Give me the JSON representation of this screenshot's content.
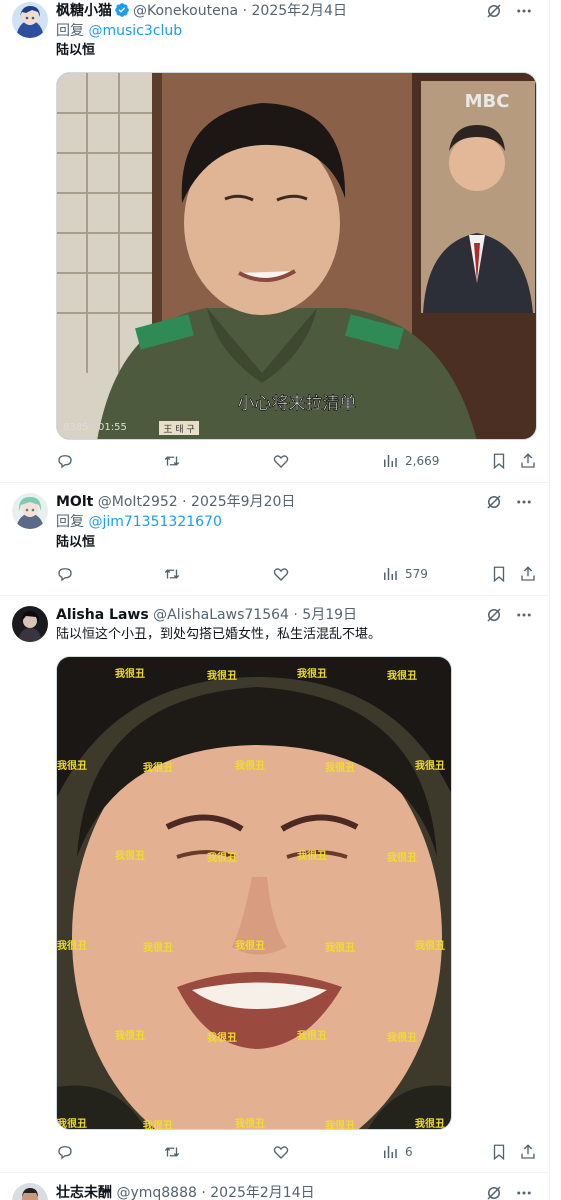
{
  "tweets": [
    {
      "name": "枫糖小猫",
      "handle": "@Konekoutena",
      "date": "2025年2月4日",
      "replying_prefix": "回复 ",
      "replying_to": "@music3club",
      "text": "陆以恒",
      "views": "2,669",
      "media": {
        "caption": "小心将来拉清单",
        "tv_logo": "MBC",
        "timestamp": "8385 · 01:55",
        "badge": "王 태 구"
      }
    },
    {
      "name": "MOlt",
      "handle": "@MoIt2952",
      "date": "2025年9月20日",
      "replying_prefix": "回复 ",
      "replying_to": "@jim71351321670",
      "text": "陆以恒",
      "views": "579"
    },
    {
      "name": "Alisha Laws",
      "handle": "@AlishaLaws71564",
      "date": "5月19日",
      "text": "陆以恒这个小丑，到处勾搭已婚女性，私生活混乱不堪。",
      "views": "6",
      "media": {
        "watermark": "我很丑"
      }
    },
    {
      "name": "壮志未酬",
      "handle": "@ymq8888",
      "date": "2025年2月14日"
    }
  ],
  "separator": " · ",
  "icons": {
    "top": [
      "grok-icon",
      "more-icon"
    ],
    "actions": [
      "reply-icon",
      "retweet-icon",
      "like-icon",
      "views-icon",
      "bookmark-icon",
      "share-icon"
    ]
  },
  "colors": {
    "link": "#1d9bf0",
    "secondary": "#536471",
    "verified": "#1d9bf0"
  }
}
